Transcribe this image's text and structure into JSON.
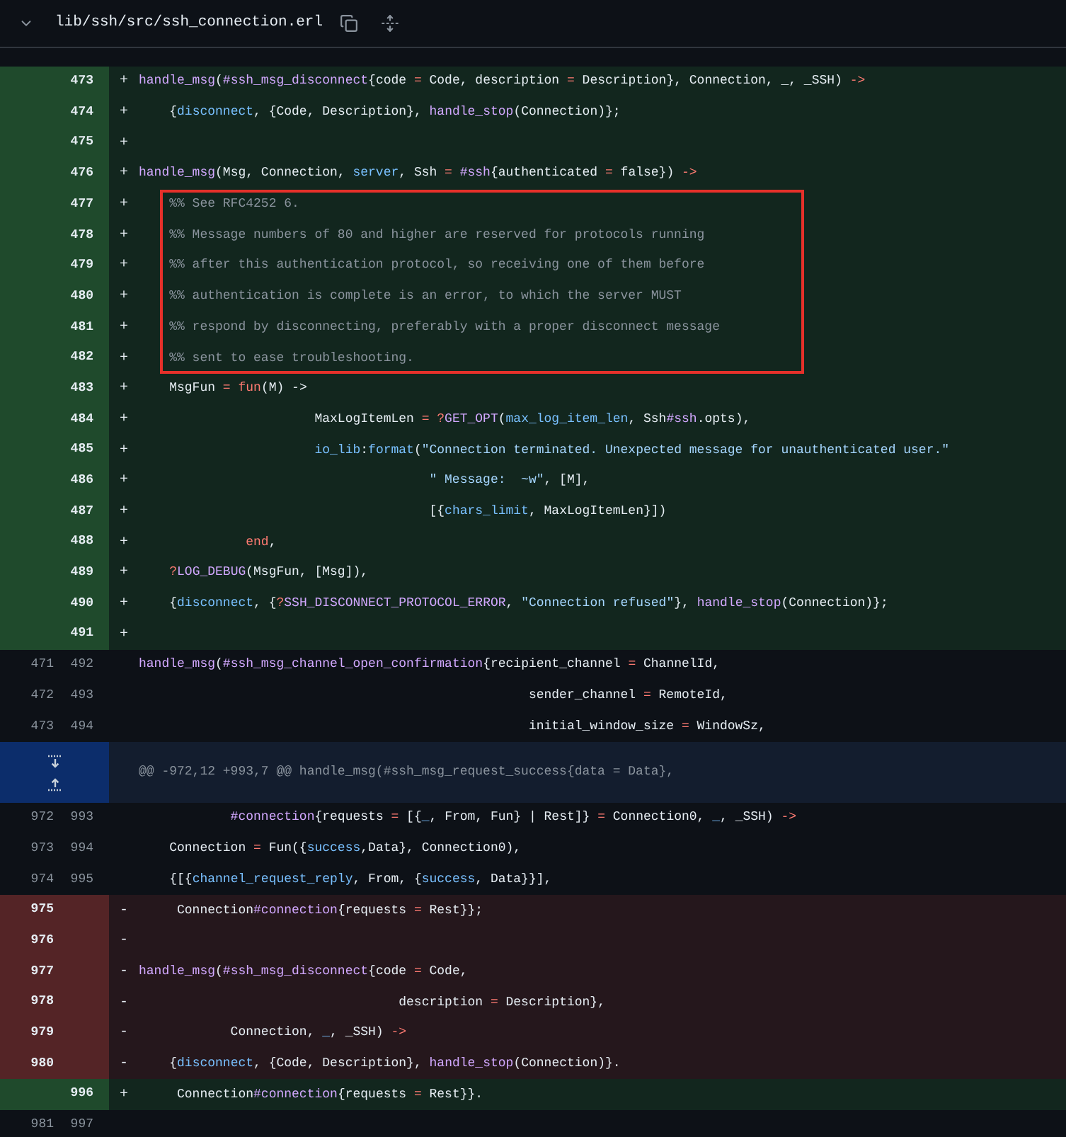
{
  "file_header": {
    "path": "lib/ssh/src/ssh_connection.erl"
  },
  "lines": [
    {
      "kind": "added",
      "new": "473",
      "marker": "+",
      "tokens": [
        {
          "text": "handle_msg",
          "kind": "fn"
        },
        {
          "text": "(",
          "kind": "plain"
        },
        {
          "text": "#ssh_msg_disconnect",
          "kind": "fn"
        },
        {
          "text": "{code ",
          "kind": "plain"
        },
        {
          "text": "=",
          "kind": "op"
        },
        {
          "text": " Code, description ",
          "kind": "plain"
        },
        {
          "text": "=",
          "kind": "op"
        },
        {
          "text": " Description}, Connection, _, _SSH) ",
          "kind": "plain"
        },
        {
          "text": "->",
          "kind": "op"
        }
      ]
    },
    {
      "kind": "added",
      "new": "474",
      "marker": "+",
      "tokens": [
        {
          "text": "    {",
          "kind": "plain"
        },
        {
          "text": "disconnect",
          "kind": "atom"
        },
        {
          "text": ", {Code, Description}, ",
          "kind": "plain"
        },
        {
          "text": "handle_stop",
          "kind": "fn"
        },
        {
          "text": "(Connection)};",
          "kind": "plain"
        }
      ]
    },
    {
      "kind": "added",
      "new": "475",
      "marker": "+"
    },
    {
      "kind": "added",
      "new": "476",
      "marker": "+",
      "tokens": [
        {
          "text": "handle_msg",
          "kind": "fn"
        },
        {
          "text": "(Msg, Connection, ",
          "kind": "plain"
        },
        {
          "text": "server",
          "kind": "atom"
        },
        {
          "text": ", Ssh ",
          "kind": "plain"
        },
        {
          "text": "= ",
          "kind": "op"
        },
        {
          "text": "#ssh",
          "kind": "fn"
        },
        {
          "text": "{authenticated ",
          "kind": "plain"
        },
        {
          "text": "=",
          "kind": "op"
        },
        {
          "text": " false}) ",
          "kind": "plain"
        },
        {
          "text": "->",
          "kind": "op"
        }
      ]
    },
    {
      "kind": "added",
      "new": "477",
      "marker": "+",
      "boxed": true,
      "tokens": [
        {
          "text": "    %% See RFC4252 6.",
          "kind": "comment"
        }
      ]
    },
    {
      "kind": "added",
      "new": "478",
      "marker": "+",
      "boxed": true,
      "tokens": [
        {
          "text": "    %% Message numbers of 80 and higher are reserved for protocols running",
          "kind": "comment"
        }
      ]
    },
    {
      "kind": "added",
      "new": "479",
      "marker": "+",
      "boxed": true,
      "tokens": [
        {
          "text": "    %% after this authentication protocol, so receiving one of them before",
          "kind": "comment"
        }
      ]
    },
    {
      "kind": "added",
      "new": "480",
      "marker": "+",
      "boxed": true,
      "tokens": [
        {
          "text": "    %% authentication is complete is an error, to which the server MUST",
          "kind": "comment"
        }
      ]
    },
    {
      "kind": "added",
      "new": "481",
      "marker": "+",
      "boxed": true,
      "tokens": [
        {
          "text": "    %% respond by disconnecting, preferably with a proper disconnect message",
          "kind": "comment"
        }
      ]
    },
    {
      "kind": "added",
      "new": "482",
      "marker": "+",
      "boxed": true,
      "tokens": [
        {
          "text": "    %% sent to ease troubleshooting.",
          "kind": "comment"
        }
      ]
    },
    {
      "kind": "added",
      "new": "483",
      "marker": "+",
      "tokens": [
        {
          "text": "    MsgFun ",
          "kind": "plain"
        },
        {
          "text": "= fun",
          "kind": "op"
        },
        {
          "text": "(M) ->",
          "kind": "plain"
        }
      ]
    },
    {
      "kind": "added",
      "new": "484",
      "marker": "+",
      "tokens": [
        {
          "text": "                       MaxLogItemLen ",
          "kind": "plain"
        },
        {
          "text": "= ?",
          "kind": "op"
        },
        {
          "text": "GET_OPT",
          "kind": "fn"
        },
        {
          "text": "(",
          "kind": "plain"
        },
        {
          "text": "max_log_item_len",
          "kind": "atom"
        },
        {
          "text": ", Ssh",
          "kind": "plain"
        },
        {
          "text": "#ssh",
          "kind": "fn"
        },
        {
          "text": ".opts),",
          "kind": "plain"
        }
      ]
    },
    {
      "kind": "added",
      "new": "485",
      "marker": "+",
      "tokens": [
        {
          "text": "                       io_lib",
          "kind": "atom"
        },
        {
          "text": ":",
          "kind": "plain"
        },
        {
          "text": "format",
          "kind": "atom"
        },
        {
          "text": "(",
          "kind": "plain"
        },
        {
          "text": "\"Connection terminated. Unexpected message for unauthenticated user.\"",
          "kind": "str"
        }
      ]
    },
    {
      "kind": "added",
      "new": "486",
      "marker": "+",
      "tokens": [
        {
          "text": "                                      \" Message:  ~w\"",
          "kind": "str"
        },
        {
          "text": ", [M],",
          "kind": "plain"
        }
      ]
    },
    {
      "kind": "added",
      "new": "487",
      "marker": "+",
      "tokens": [
        {
          "text": "                                      [{",
          "kind": "plain"
        },
        {
          "text": "chars_limit",
          "kind": "atom"
        },
        {
          "text": ", MaxLogItemLen}])",
          "kind": "plain"
        }
      ]
    },
    {
      "kind": "added",
      "new": "488",
      "marker": "+",
      "tokens": [
        {
          "text": "              end",
          "kind": "op"
        },
        {
          "text": ",",
          "kind": "plain"
        }
      ]
    },
    {
      "kind": "added",
      "new": "489",
      "marker": "+",
      "tokens": [
        {
          "text": "    ?",
          "kind": "op"
        },
        {
          "text": "LOG_DEBUG",
          "kind": "fn"
        },
        {
          "text": "(MsgFun, [Msg]),",
          "kind": "plain"
        }
      ]
    },
    {
      "kind": "added",
      "new": "490",
      "marker": "+",
      "tokens": [
        {
          "text": "    {",
          "kind": "plain"
        },
        {
          "text": "disconnect",
          "kind": "atom"
        },
        {
          "text": ", {",
          "kind": "plain"
        },
        {
          "text": "?",
          "kind": "op"
        },
        {
          "text": "SSH_DISCONNECT_PROTOCOL_ERROR",
          "kind": "fn"
        },
        {
          "text": ", ",
          "kind": "plain"
        },
        {
          "text": "\"Connection refused\"",
          "kind": "str"
        },
        {
          "text": "}, ",
          "kind": "plain"
        },
        {
          "text": "handle_stop",
          "kind": "fn"
        },
        {
          "text": "(Connection)};",
          "kind": "plain"
        }
      ]
    },
    {
      "kind": "added",
      "new": "491",
      "marker": "+"
    },
    {
      "kind": "context",
      "old": "471",
      "new": "492",
      "tokens": [
        {
          "text": "handle_msg",
          "kind": "fn"
        },
        {
          "text": "(",
          "kind": "plain"
        },
        {
          "text": "#ssh_msg_channel_open_confirmation",
          "kind": "fn"
        },
        {
          "text": "{recipient_channel ",
          "kind": "plain"
        },
        {
          "text": "=",
          "kind": "op"
        },
        {
          "text": " ChannelId,",
          "kind": "plain"
        }
      ]
    },
    {
      "kind": "context",
      "old": "472",
      "new": "493",
      "tokens": [
        {
          "text": "                                                   sender_channel ",
          "kind": "plain"
        },
        {
          "text": "=",
          "kind": "op"
        },
        {
          "text": " RemoteId,",
          "kind": "plain"
        }
      ]
    },
    {
      "kind": "context",
      "old": "473",
      "new": "494",
      "tokens": [
        {
          "text": "                                                   initial_window_size ",
          "kind": "plain"
        },
        {
          "text": "=",
          "kind": "op"
        },
        {
          "text": " WindowSz,",
          "kind": "plain"
        }
      ]
    },
    {
      "kind": "hunk",
      "tokens": [
        {
          "text": "@@ -972,12 +993,7 @@ handle_msg(#ssh_msg_request_success{data = Data},",
          "kind": "hunk"
        }
      ]
    },
    {
      "kind": "context",
      "old": "972",
      "new": "993",
      "tokens": [
        {
          "text": "            #connection",
          "kind": "fn"
        },
        {
          "text": "{requests ",
          "kind": "plain"
        },
        {
          "text": "=",
          "kind": "op"
        },
        {
          "text": " [{",
          "kind": "plain"
        },
        {
          "text": "_",
          "kind": "atom"
        },
        {
          "text": ", From, Fun} | Rest]} ",
          "kind": "plain"
        },
        {
          "text": "=",
          "kind": "op"
        },
        {
          "text": " Connection0, ",
          "kind": "plain"
        },
        {
          "text": "_",
          "kind": "atom"
        },
        {
          "text": ", _SSH) ",
          "kind": "plain"
        },
        {
          "text": "->",
          "kind": "op"
        }
      ]
    },
    {
      "kind": "context",
      "old": "973",
      "new": "994",
      "tokens": [
        {
          "text": "    Connection ",
          "kind": "plain"
        },
        {
          "text": "=",
          "kind": "op"
        },
        {
          "text": " Fun({",
          "kind": "plain"
        },
        {
          "text": "success",
          "kind": "atom"
        },
        {
          "text": ",Data}, Connection0),",
          "kind": "plain"
        }
      ]
    },
    {
      "kind": "context",
      "old": "974",
      "new": "995",
      "tokens": [
        {
          "text": "    {[{",
          "kind": "plain"
        },
        {
          "text": "channel_request_reply",
          "kind": "atom"
        },
        {
          "text": ", From, {",
          "kind": "plain"
        },
        {
          "text": "success",
          "kind": "atom"
        },
        {
          "text": ", Data}}],",
          "kind": "plain"
        }
      ]
    },
    {
      "kind": "deleted",
      "old": "975",
      "marker": "-",
      "tokens": [
        {
          "text": "     Connection",
          "kind": "plain"
        },
        {
          "text": "#connection",
          "kind": "fn"
        },
        {
          "text": "{requests ",
          "kind": "plain"
        },
        {
          "text": "=",
          "kind": "op"
        },
        {
          "text": " Rest}};",
          "kind": "plain"
        }
      ]
    },
    {
      "kind": "deleted",
      "old": "976",
      "marker": "-"
    },
    {
      "kind": "deleted",
      "old": "977",
      "marker": "-",
      "tokens": [
        {
          "text": "handle_msg",
          "kind": "fn"
        },
        {
          "text": "(",
          "kind": "plain"
        },
        {
          "text": "#ssh_msg_disconnect",
          "kind": "fn"
        },
        {
          "text": "{code ",
          "kind": "plain"
        },
        {
          "text": "=",
          "kind": "op"
        },
        {
          "text": " Code,",
          "kind": "plain"
        }
      ]
    },
    {
      "kind": "deleted",
      "old": "978",
      "marker": "-",
      "tokens": [
        {
          "text": "                                  description ",
          "kind": "plain"
        },
        {
          "text": "=",
          "kind": "op"
        },
        {
          "text": " Description},",
          "kind": "plain"
        }
      ]
    },
    {
      "kind": "deleted",
      "old": "979",
      "marker": "-",
      "tokens": [
        {
          "text": "            Connection, ",
          "kind": "plain"
        },
        {
          "text": "_",
          "kind": "atom"
        },
        {
          "text": ", _SSH) ",
          "kind": "plain"
        },
        {
          "text": "->",
          "kind": "op"
        }
      ]
    },
    {
      "kind": "deleted",
      "old": "980",
      "marker": "-",
      "tokens": [
        {
          "text": "    {",
          "kind": "plain"
        },
        {
          "text": "disconnect",
          "kind": "atom"
        },
        {
          "text": ", {Code, Description}, ",
          "kind": "plain"
        },
        {
          "text": "handle_stop",
          "kind": "fn"
        },
        {
          "text": "(Connection)}.",
          "kind": "plain"
        }
      ]
    },
    {
      "kind": "added",
      "new": "996",
      "marker": "+",
      "tokens": [
        {
          "text": "     Connection",
          "kind": "plain"
        },
        {
          "text": "#connection",
          "kind": "fn"
        },
        {
          "text": "{requests ",
          "kind": "plain"
        },
        {
          "text": "=",
          "kind": "op"
        },
        {
          "text": " Rest}}.",
          "kind": "plain"
        }
      ]
    },
    {
      "kind": "context",
      "old": "981",
      "new": "997"
    }
  ]
}
